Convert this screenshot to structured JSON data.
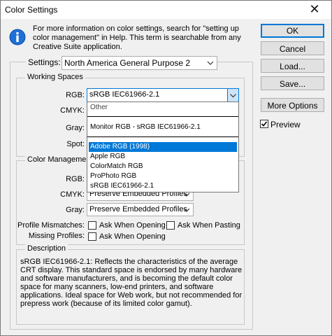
{
  "window": {
    "title": "Color Settings",
    "close_glyph": "✕"
  },
  "info": {
    "icon": "info-icon",
    "text": "For more information on color settings, search for \"setting up\ncolor management\" in Help. This term is searchable from any\nCreative Suite application."
  },
  "buttons": {
    "ok": "OK",
    "cancel": "Cancel",
    "load": "Load...",
    "save": "Save...",
    "more_options": "More Options"
  },
  "preview": {
    "label": "Preview",
    "checked": true
  },
  "settings": {
    "label": "Settings:",
    "value": "North America General Purpose 2"
  },
  "working_spaces": {
    "title": "Working Spaces",
    "rgb_label": "RGB:",
    "rgb_value": "sRGB IEC61966-2.1",
    "cmyk_label": "CMYK:",
    "gray_label": "Gray:",
    "spot_label": "Spot:"
  },
  "dropdown": {
    "other": "Other",
    "monitor": "Monitor RGB - sRGB IEC61966-2.1",
    "items": [
      "Adobe RGB (1998)",
      "Apple RGB",
      "ColorMatch RGB",
      "ProPhoto RGB",
      "sRGB IEC61966-2.1"
    ],
    "highlighted": "Adobe RGB (1998)"
  },
  "color_management": {
    "title": "Color Management",
    "rgb_label": "RGB:",
    "cmyk_label": "CMYK:",
    "cmyk_value": "Preserve Embedded Profiles",
    "gray_label": "Gray:",
    "gray_value": "Preserve Embedded Profiles",
    "mismatch_label": "Profile Mismatches:",
    "ask_opening": "Ask When Opening",
    "ask_pasting": "Ask When Pasting",
    "missing_label": "Missing Profiles:",
    "ask_opening_missing": "Ask When Opening"
  },
  "description": {
    "title": "Description",
    "text": "sRGB IEC61966-2.1:  Reflects the characteristics of the average CRT display.  This standard space is endorsed by many hardware and software manufacturers, and is becoming the default color space for many scanners, low-end printers, and software applications.  Ideal space for Web work, but not recommended for prepress work (because of its limited color gamut)."
  }
}
